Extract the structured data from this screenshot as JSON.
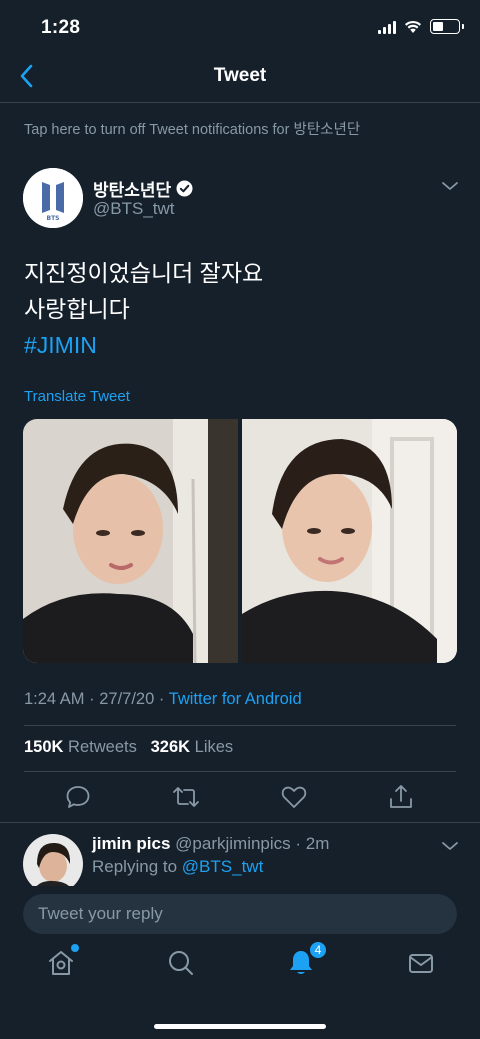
{
  "status_bar": {
    "time": "1:28"
  },
  "nav": {
    "title": "Tweet"
  },
  "banner": {
    "text": "Tap here to turn off Tweet notifications for 방탄소년단"
  },
  "tweet": {
    "user_name": "방탄소년단",
    "handle": "@BTS_twt",
    "avatar_logo_text": "BTS",
    "lines": [
      "지진정이었습니더 잘자요",
      "사랑합니다"
    ],
    "hashtag": "#JIMIN",
    "translate_label": "Translate Tweet",
    "time": "1:24 AM",
    "date": "27/7/20",
    "source": "Twitter for Android",
    "retweets_count": "150K",
    "retweets_label": "Retweets",
    "likes_count": "326K",
    "likes_label": "Likes"
  },
  "reply": {
    "user_name": "jimin pics",
    "handle": "@parkjiminpics",
    "time": "· 2m",
    "replying_prefix": "Replying to",
    "replying_handle": "@BTS_twt"
  },
  "composer": {
    "placeholder": "Tweet your reply"
  },
  "tab_bar": {
    "notifications_badge": "4"
  },
  "colors": {
    "background": "#15202b",
    "accent": "#1da1f2",
    "muted": "#8899a6",
    "divider": "#38444d"
  }
}
